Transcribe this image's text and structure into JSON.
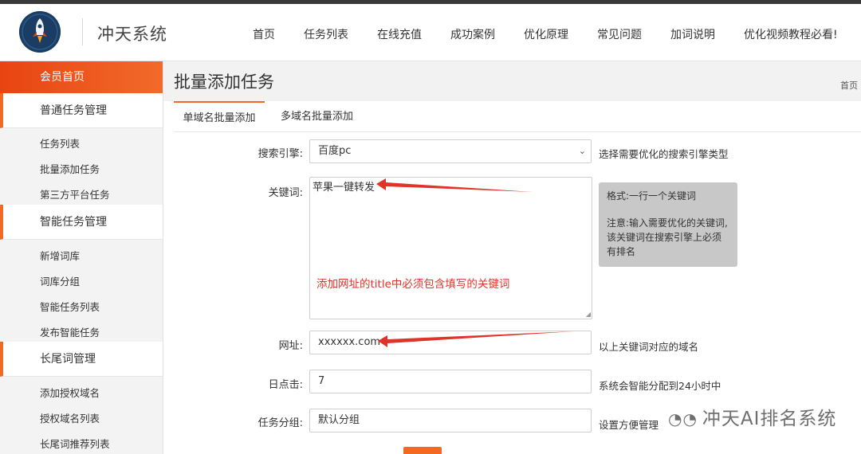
{
  "header": {
    "brand": "冲天系统",
    "nav": [
      "首页",
      "任务列表",
      "在线充值",
      "成功案例",
      "优化原理",
      "常见问题",
      "加词说明",
      "优化视频教程必看!"
    ]
  },
  "sidebar": {
    "home": "会员首页",
    "groups": [
      {
        "title": "普通任务管理",
        "items": [
          "任务列表",
          "批量添加任务",
          "第三方平台任务"
        ]
      },
      {
        "title": "智能任务管理",
        "items": [
          "新增词库",
          "词库分组",
          "智能任务列表",
          "发布智能任务"
        ]
      },
      {
        "title": "长尾词管理",
        "items": [
          "添加授权域名",
          "授权域名列表",
          "长尾词推荐列表"
        ]
      }
    ]
  },
  "main": {
    "title": "批量添加任务",
    "breadcrumb": "首页",
    "tabs": [
      "单域名批量添加",
      "多域名批量添加"
    ]
  },
  "form": {
    "engine": {
      "label": "搜索引擎:",
      "value": "百度pc",
      "hint": "选择需要优化的搜索引擎类型"
    },
    "keywords": {
      "label": "关键词:",
      "value": "苹果一键转发",
      "note_line1": "格式:一行一个关键词",
      "note_line2": "注意:输入需要优化的关键词,该关键词在搜索引擎上必须有排名"
    },
    "url": {
      "label": "网址:",
      "value": "xxxxxx.com",
      "hint": "以上关键词对应的域名"
    },
    "clicks": {
      "label": "日点击:",
      "value": "7",
      "hint": "系统会智能分配到24小时中"
    },
    "group": {
      "label": "任务分组:",
      "value": "默认分组",
      "hint": "设置方便管理"
    }
  },
  "annotation": "添加网址的title中必须包含填写的关键词",
  "watermark": "冲天AI排名系统",
  "colors": {
    "accent": "#f06a26",
    "annotation": "#e0332a",
    "header_bar": "#3a3a3a"
  }
}
